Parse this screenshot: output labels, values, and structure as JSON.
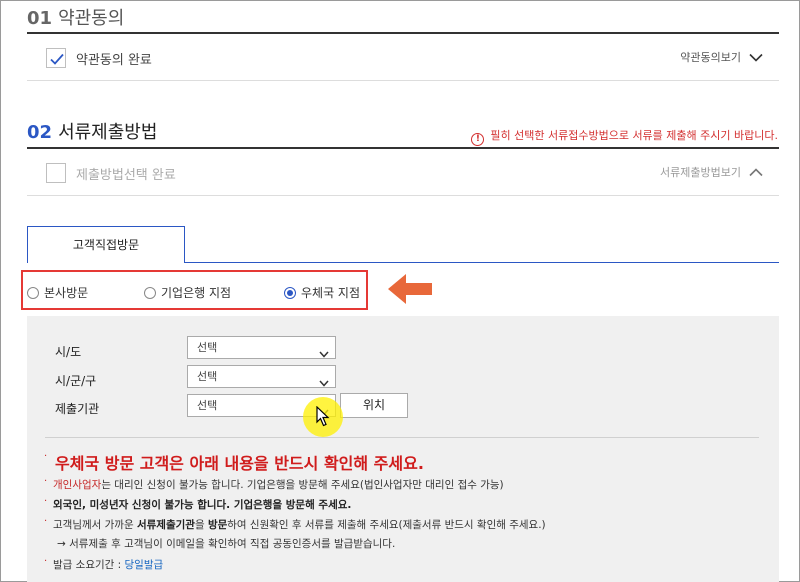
{
  "section1": {
    "number": "01",
    "title": "약관동의",
    "check_label": "약관동의 완료",
    "toggle_label": "약관동의보기"
  },
  "section2": {
    "number": "02",
    "title": "서류제출방법",
    "notice": "필히 선택한 서류접수방법으로 서류를 제출해 주시기 바랍니다.",
    "check_label": "제출방법선택 완료",
    "toggle_label": "서류제출방법보기"
  },
  "tab": {
    "label": "고객직접방문"
  },
  "radios": [
    {
      "label": "본사방문",
      "selected": false
    },
    {
      "label": "기업은행 지점",
      "selected": false
    },
    {
      "label": "우체국 지점",
      "selected": true
    }
  ],
  "form": {
    "sido_label": "시/도",
    "sido_value": "선택",
    "sigungu_label": "시/군/구",
    "sigungu_value": "선택",
    "office_label": "제출기관",
    "office_value": "선택",
    "location_button": "위치"
  },
  "notes": {
    "title": "우체국 방문 고객은 아래 내용을 반드시 확인해 주세요.",
    "line1_highlight": "개인사업자",
    "line1_rest": "는 대리인 신청이 불가능 합니다. 기업은행을 방문해 주세요(법인사업자만 대리인 접수 가능)",
    "line2": "외국인, 미성년자 신청이 불가능 합니다. 기업은행을 방문해 주세요.",
    "line3_pre": "고객님께서 가까운 ",
    "line3_bold": "서류제출기관",
    "line3_mid": "을 ",
    "line3_bold2": "방문",
    "line3_rest": "하여 신원확인 후 서류를 제출해 주세요(제출서류 반드시 확인해 주세요.)",
    "line4": "→ 서류제출 후 고객님이 이메일을 확인하여 직접 공동인증서를 발급받습니다.",
    "line5_label": "발급 소요기간 : ",
    "line5_value": "당일발급"
  },
  "colors": {
    "accent_blue": "#2b57c4",
    "alert_red": "#d32f2f",
    "arrow_orange": "#e8683a",
    "panel_gray": "#f0f0f0"
  }
}
